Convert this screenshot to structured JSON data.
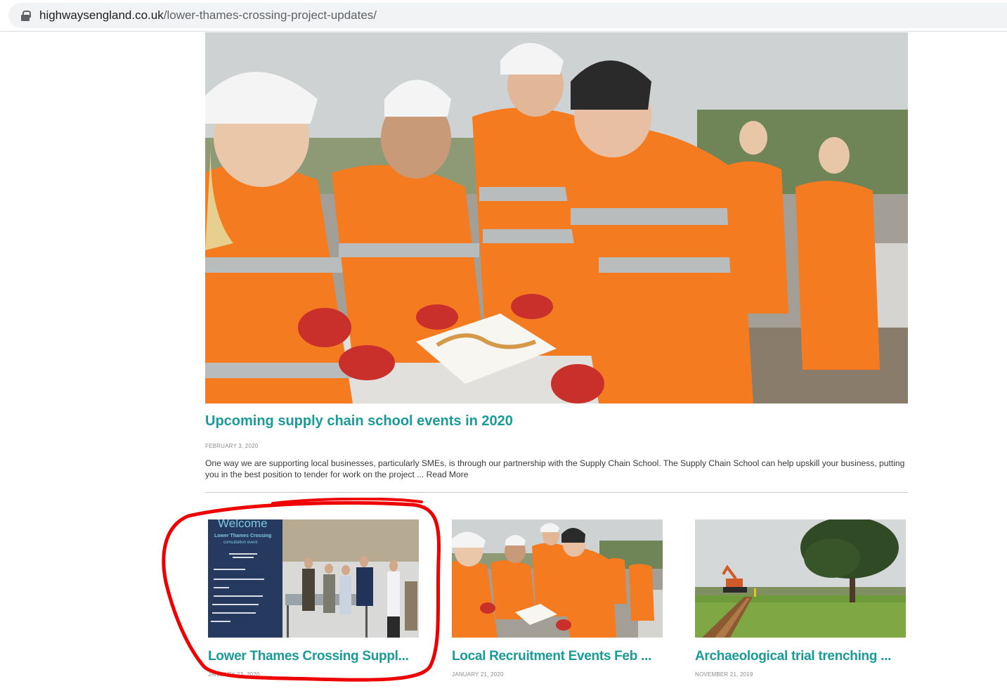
{
  "browser": {
    "url_host": "highwaysengland.co.uk",
    "url_path": "/lower-thames-crossing-project-updates/"
  },
  "featured_post": {
    "title": "Upcoming supply chain school events in 2020",
    "date": "FEBRUARY 3, 2020",
    "excerpt": "One way we are supporting local businesses, particularly SMEs, is through our partnership with the Supply Chain School. The Supply Chain School can help upskill your business, putting you in the best position to tender for work on the project ...",
    "read_more": "Read More"
  },
  "cards": [
    {
      "title": "Lower Thames Crossing Suppl...",
      "date": "JANUARY 23, 2020",
      "banner_heading": "Welcome",
      "banner_sub1": "Lower Thames Crossing",
      "banner_sub2": "consultation event"
    },
    {
      "title": "Local Recruitment Events Feb ...",
      "date": "JANUARY 21, 2020"
    },
    {
      "title": "Archaeological trial trenching ...",
      "date": "NOVEMBER 21, 2019"
    }
  ],
  "colors": {
    "link_teal": "#1a9a98",
    "hivis_orange": "#f47b20",
    "annotation_red": "#ee0000"
  }
}
